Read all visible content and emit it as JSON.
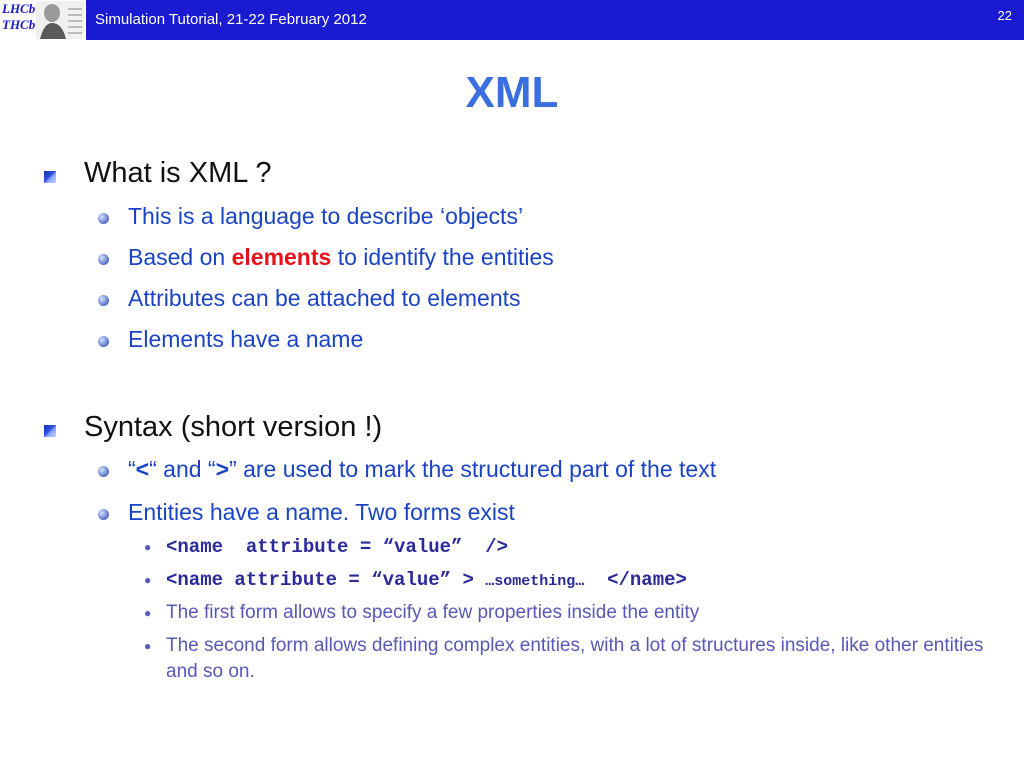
{
  "header": {
    "logo_text_1": "LHCb",
    "logo_text_2": "THCb",
    "title": "Simulation Tutorial, 21-22 February 2012",
    "page_number": "22"
  },
  "slide": {
    "title": "XML"
  },
  "section1": {
    "heading": "What is XML ?",
    "items": [
      "This is a language to describe ‘objects’",
      {
        "before": "Based on ",
        "highlight": "elements",
        "after": " to identify the entities"
      },
      "Attributes can be attached to elements",
      "Elements have a name"
    ]
  },
  "section2": {
    "heading": "Syntax (short version !)",
    "item1": {
      "q1": "“",
      "lt": "<",
      "mid": "“ and “",
      "gt": ">",
      "after": "” are used to mark the structured part of the text"
    },
    "item2": "Entities have a name. Two forms exist",
    "forms": [
      {
        "code": "<name  attribute = “value”  />"
      },
      {
        "code": "<name attribute = “value” > ",
        "inner": "…something…",
        "end": "  </name>"
      },
      "The first form allows to specify a few properties inside the entity",
      "The second form allows defining complex entities, with a lot of structures inside, like other entities and so on."
    ]
  }
}
